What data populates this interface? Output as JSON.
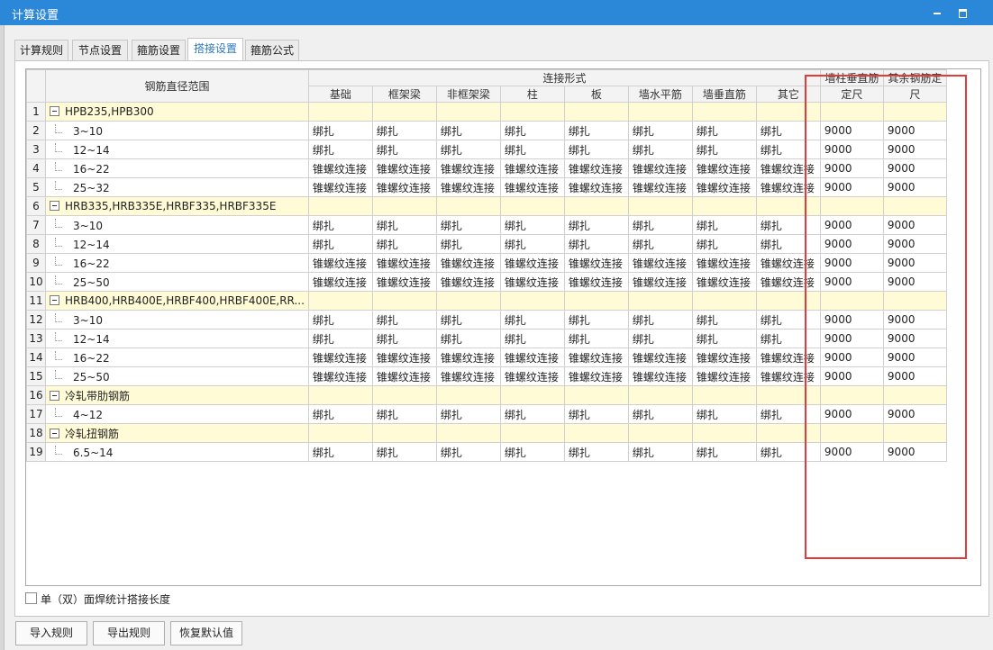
{
  "window": {
    "title": "计算设置"
  },
  "tabs": [
    {
      "label": "计算规则"
    },
    {
      "label": "节点设置"
    },
    {
      "label": "箍筋设置"
    },
    {
      "label": "搭接设置"
    },
    {
      "label": "箍筋公式"
    }
  ],
  "active_tab": "搭接设置",
  "table": {
    "range_header": "钢筋直径范围",
    "group_header": "连接形式",
    "columns": [
      "基础",
      "框架梁",
      "非框架梁",
      "柱",
      "板",
      "墙水平筋",
      "墙垂直筋",
      "其它"
    ],
    "extra_col1_line1": "墙柱垂直筋",
    "extra_col1_line2": "定尺",
    "extra_col2_line1": "其余钢筋定",
    "extra_col2_line2": "尺",
    "rows": [
      {
        "num": "1",
        "type": "group",
        "label": "HPB235,HPB300"
      },
      {
        "num": "2",
        "type": "item",
        "label": "3~10",
        "cells": [
          "绑扎",
          "绑扎",
          "绑扎",
          "绑扎",
          "绑扎",
          "绑扎",
          "绑扎",
          "绑扎"
        ],
        "len1": "9000",
        "len2": "9000"
      },
      {
        "num": "3",
        "type": "item",
        "label": "12~14",
        "cells": [
          "绑扎",
          "绑扎",
          "绑扎",
          "绑扎",
          "绑扎",
          "绑扎",
          "绑扎",
          "绑扎"
        ],
        "len1": "9000",
        "len2": "9000"
      },
      {
        "num": "4",
        "type": "item",
        "label": "16~22",
        "cells": [
          "锥螺纹连接",
          "锥螺纹连接",
          "锥螺纹连接",
          "锥螺纹连接",
          "锥螺纹连接",
          "锥螺纹连接",
          "锥螺纹连接",
          "锥螺纹连接"
        ],
        "len1": "9000",
        "len2": "9000"
      },
      {
        "num": "5",
        "type": "item",
        "label": "25~32",
        "cells": [
          "锥螺纹连接",
          "锥螺纹连接",
          "锥螺纹连接",
          "锥螺纹连接",
          "锥螺纹连接",
          "锥螺纹连接",
          "锥螺纹连接",
          "锥螺纹连接"
        ],
        "len1": "9000",
        "len2": "9000"
      },
      {
        "num": "6",
        "type": "group",
        "label": "HRB335,HRB335E,HRBF335,HRBF335E"
      },
      {
        "num": "7",
        "type": "item",
        "label": "3~10",
        "cells": [
          "绑扎",
          "绑扎",
          "绑扎",
          "绑扎",
          "绑扎",
          "绑扎",
          "绑扎",
          "绑扎"
        ],
        "len1": "9000",
        "len2": "9000"
      },
      {
        "num": "8",
        "type": "item",
        "label": "12~14",
        "cells": [
          "绑扎",
          "绑扎",
          "绑扎",
          "绑扎",
          "绑扎",
          "绑扎",
          "绑扎",
          "绑扎"
        ],
        "len1": "9000",
        "len2": "9000"
      },
      {
        "num": "9",
        "type": "item",
        "label": "16~22",
        "cells": [
          "锥螺纹连接",
          "锥螺纹连接",
          "锥螺纹连接",
          "锥螺纹连接",
          "锥螺纹连接",
          "锥螺纹连接",
          "锥螺纹连接",
          "锥螺纹连接"
        ],
        "len1": "9000",
        "len2": "9000"
      },
      {
        "num": "10",
        "type": "item",
        "label": "25~50",
        "cells": [
          "锥螺纹连接",
          "锥螺纹连接",
          "锥螺纹连接",
          "锥螺纹连接",
          "锥螺纹连接",
          "锥螺纹连接",
          "锥螺纹连接",
          "锥螺纹连接"
        ],
        "len1": "9000",
        "len2": "9000"
      },
      {
        "num": "11",
        "type": "group",
        "label": "HRB400,HRB400E,HRBF400,HRBF400E,RR..."
      },
      {
        "num": "12",
        "type": "item",
        "label": "3~10",
        "cells": [
          "绑扎",
          "绑扎",
          "绑扎",
          "绑扎",
          "绑扎",
          "绑扎",
          "绑扎",
          "绑扎"
        ],
        "len1": "9000",
        "len2": "9000"
      },
      {
        "num": "13",
        "type": "item",
        "label": "12~14",
        "cells": [
          "绑扎",
          "绑扎",
          "绑扎",
          "绑扎",
          "绑扎",
          "绑扎",
          "绑扎",
          "绑扎"
        ],
        "len1": "9000",
        "len2": "9000"
      },
      {
        "num": "14",
        "type": "item",
        "label": "16~22",
        "cells": [
          "锥螺纹连接",
          "锥螺纹连接",
          "锥螺纹连接",
          "锥螺纹连接",
          "锥螺纹连接",
          "锥螺纹连接",
          "锥螺纹连接",
          "锥螺纹连接"
        ],
        "len1": "9000",
        "len2": "9000"
      },
      {
        "num": "15",
        "type": "item",
        "label": "25~50",
        "cells": [
          "锥螺纹连接",
          "锥螺纹连接",
          "锥螺纹连接",
          "锥螺纹连接",
          "锥螺纹连接",
          "锥螺纹连接",
          "锥螺纹连接",
          "锥螺纹连接"
        ],
        "len1": "9000",
        "len2": "9000"
      },
      {
        "num": "16",
        "type": "group",
        "label": "冷轧带肋钢筋"
      },
      {
        "num": "17",
        "type": "item",
        "label": "4~12",
        "cells": [
          "绑扎",
          "绑扎",
          "绑扎",
          "绑扎",
          "绑扎",
          "绑扎",
          "绑扎",
          "绑扎"
        ],
        "len1": "9000",
        "len2": "9000"
      },
      {
        "num": "18",
        "type": "group",
        "label": "冷轧扭钢筋"
      },
      {
        "num": "19",
        "type": "item",
        "label": "6.5~14",
        "cells": [
          "绑扎",
          "绑扎",
          "绑扎",
          "绑扎",
          "绑扎",
          "绑扎",
          "绑扎",
          "绑扎"
        ],
        "len1": "9000",
        "len2": "9000"
      }
    ]
  },
  "checkbox": {
    "label": "单（双）面焊统计搭接长度",
    "checked": false
  },
  "buttons": {
    "import": "导入规则",
    "export": "导出规则",
    "restore": "恢复默认值"
  },
  "colors": {
    "titlebar": "#2b87d8",
    "group_row": "#fffbd6",
    "highlight_box": "#e23b3b",
    "active_tab_text": "#2b78c2"
  }
}
